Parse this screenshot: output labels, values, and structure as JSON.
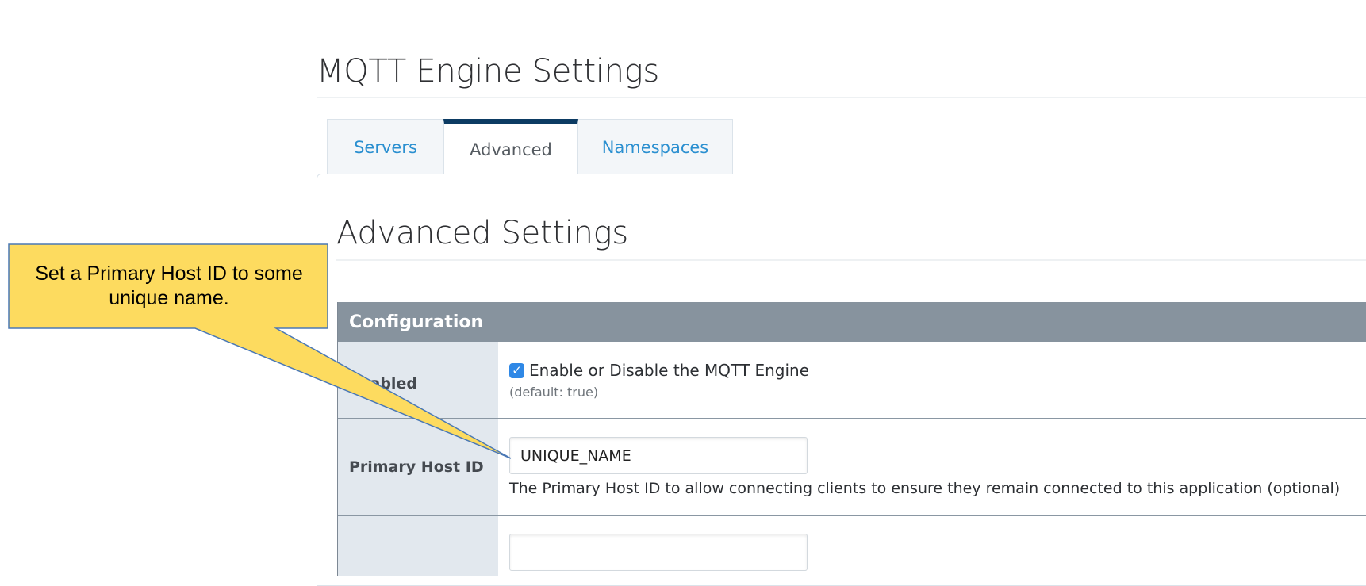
{
  "page": {
    "title": "MQTT Engine Settings"
  },
  "tabs": [
    {
      "label": "Servers",
      "active": false
    },
    {
      "label": "Advanced",
      "active": true
    },
    {
      "label": "Namespaces",
      "active": false
    }
  ],
  "section": {
    "title": "Advanced Settings"
  },
  "config": {
    "header": "Configuration",
    "rows": [
      {
        "label": "Enabled",
        "checkbox_label": "Enable or Disable the MQTT Engine",
        "checked": true,
        "default_text": "(default: true)"
      },
      {
        "label": "Primary Host ID",
        "value": "UNIQUE_NAME",
        "help_text": "The Primary Host ID to allow connecting clients to ensure they remain connected to this application (optional)"
      },
      {
        "label": "",
        "value": ""
      }
    ]
  },
  "callout": {
    "text": "Set a Primary Host ID to some unique name."
  },
  "colors": {
    "callout_fill": "#fddb5f",
    "callout_stroke": "#4a78b5",
    "active_tab_accent": "#0c3b63",
    "link_blue": "#2a8fd0",
    "header_gray": "#87939e"
  },
  "icons": {
    "checkbox": "checkmark-icon"
  }
}
